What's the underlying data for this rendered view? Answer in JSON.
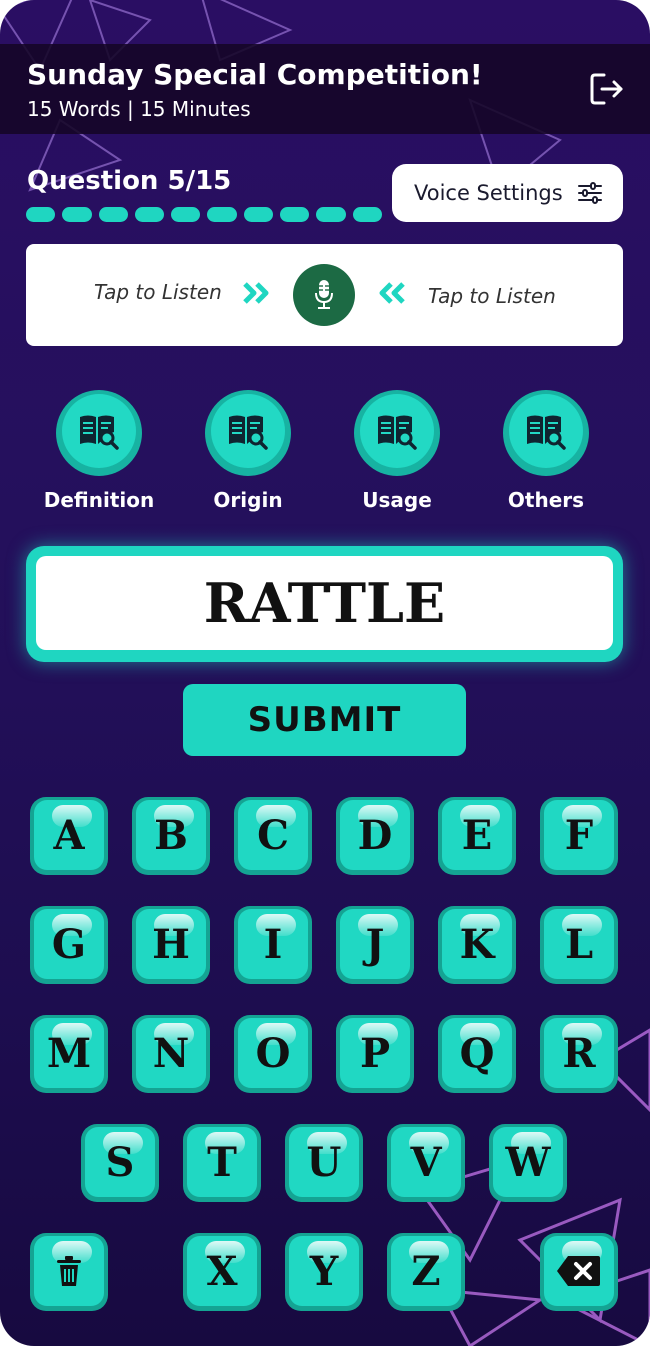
{
  "header": {
    "title": "Sunday Special Competition!",
    "subtitle": "15 Words | 15 Minutes"
  },
  "question": {
    "label": "Question 5/15",
    "current": 5,
    "total": 15
  },
  "voice_settings": {
    "label": "Voice Settings"
  },
  "listen": {
    "left_label": "Tap to Listen",
    "right_label": "Tap to Listen"
  },
  "hints": [
    {
      "label": "Definition",
      "icon": "book-search-icon"
    },
    {
      "label": "Origin",
      "icon": "book-search-icon"
    },
    {
      "label": "Usage",
      "icon": "book-search-icon"
    },
    {
      "label": "Others",
      "icon": "book-search-icon"
    }
  ],
  "answer": {
    "value": "RATTLE"
  },
  "submit": {
    "label": "SUBMIT"
  },
  "keyboard": {
    "rows": [
      [
        "A",
        "B",
        "C",
        "D",
        "E",
        "F"
      ],
      [
        "G",
        "H",
        "I",
        "J",
        "K",
        "L"
      ],
      [
        "M",
        "N",
        "O",
        "P",
        "Q",
        "R"
      ],
      [
        "S",
        "T",
        "U",
        "V",
        "W"
      ],
      [
        "X",
        "Y",
        "Z"
      ]
    ],
    "left_action": "trash-icon",
    "right_action": "backspace-icon"
  },
  "colors": {
    "accent": "#1fd6c1",
    "background": "#24105c",
    "mic": "#1c6a44"
  }
}
